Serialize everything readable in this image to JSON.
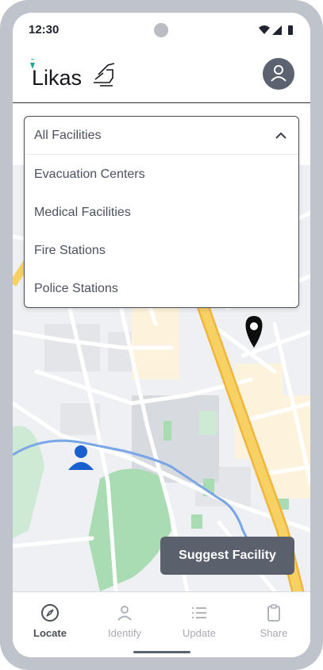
{
  "status_bar": {
    "time": "12:30"
  },
  "header": {
    "logo_text": "Likas"
  },
  "filter": {
    "selected": "All Facilities",
    "options": [
      "Evacuation Centers",
      "Medical Facilities",
      "Fire Stations",
      "Police Stations"
    ]
  },
  "map": {
    "marker_icon": "location-pin-icon",
    "user_icon": "person-icon"
  },
  "actions": {
    "suggest_label": "Suggest Facility"
  },
  "nav": [
    {
      "label": "Locate",
      "icon": "compass-icon",
      "active": true
    },
    {
      "label": "Identify",
      "icon": "person-icon",
      "active": false
    },
    {
      "label": "Update",
      "icon": "list-icon",
      "active": false
    },
    {
      "label": "Share",
      "icon": "clipboard-icon",
      "active": false
    }
  ],
  "colors": {
    "accent": "#1a5fd0",
    "button": "#5a606c",
    "road_major": "#f7d163",
    "park": "#a9dcb3"
  }
}
